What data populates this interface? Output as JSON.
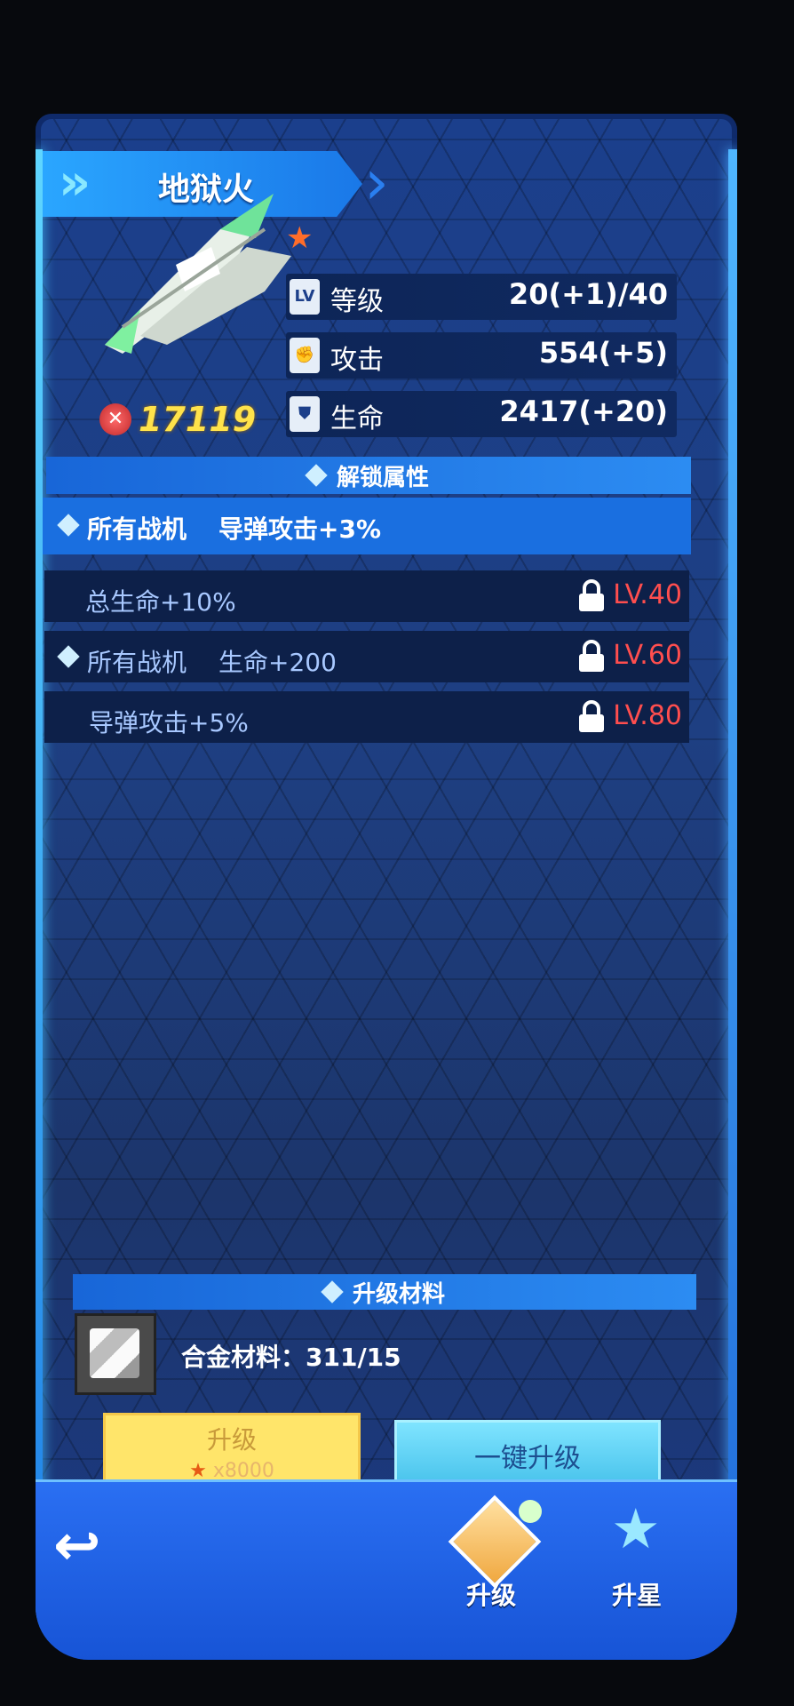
{
  "header": {
    "title": "地狱火"
  },
  "fighter": {
    "power": "17119",
    "quality_icon": "star-icon"
  },
  "stats": [
    {
      "icon_text": "LV",
      "label": "等级",
      "value": "20(+1)/40"
    },
    {
      "icon_text": "",
      "label": "攻击",
      "value": "554(+5)"
    },
    {
      "icon_text": "",
      "label": "生命",
      "value": "2417(+20)"
    }
  ],
  "unlock": {
    "section_title": "解锁属性",
    "current": {
      "target": "所有战机",
      "effect": "导弹攻击+3%"
    },
    "rows": [
      {
        "target": "",
        "effect": "总生命+10%",
        "level": "LV.40"
      },
      {
        "target": "所有战机",
        "effect": "生命+200",
        "level": "LV.60"
      },
      {
        "target": "",
        "effect": "导弹攻击+5%",
        "level": "LV.80"
      }
    ]
  },
  "materials": {
    "section_title": "升级材料",
    "label": "合金材料：311/15"
  },
  "buttons": {
    "upgrade_label": "升级",
    "upgrade_cost": "x8000",
    "one_click_label": "一键升级"
  },
  "bottom_nav": {
    "upgrade_tab": "升级",
    "star_tab": "升星"
  },
  "colors": {
    "accent": "#2a8cf2",
    "locked_level": "#ff4e4e",
    "power": "#ffe24a"
  }
}
